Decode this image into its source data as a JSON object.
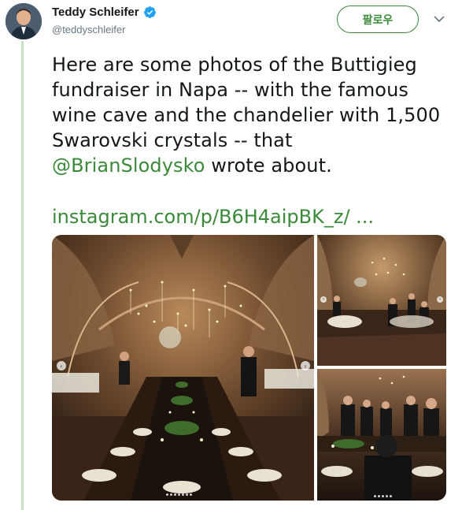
{
  "author": {
    "display_name": "Teddy Schleifer",
    "handle": "@teddyschleifer",
    "verified_icon": "verified-badge-icon"
  },
  "actions": {
    "follow_label": "팔로우",
    "more_icon": "chevron-down-icon"
  },
  "tweet": {
    "line1": "Here are some photos of the Buttigieg",
    "line2": "fundraiser in Napa -- with the famous",
    "line3": "wine cave and the chandelier with 1,500",
    "line4": "Swarovski crystals -- that",
    "mention": "@BrianSlodysko",
    "line5_rest": " wrote about.",
    "link": "instagram.com/p/B6H4aipBK_z/ ..."
  },
  "colors": {
    "accent": "#3a8a3a",
    "thread_line": "#c4e3c4",
    "verified": "#1da1f2"
  },
  "media": {
    "photos": [
      "wine-cave-dinner-table",
      "wine-cave-chandelier-guests",
      "wine-cave-guests-seated"
    ]
  }
}
